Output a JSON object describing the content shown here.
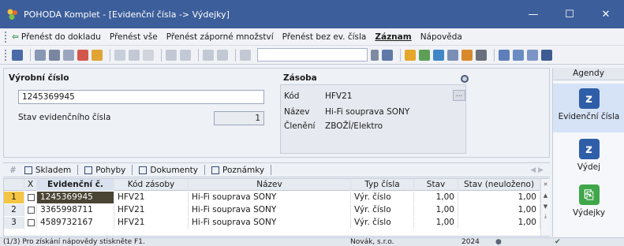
{
  "window": {
    "title": "POHODA Komplet - [Evidenční čísla -> Výdejky]",
    "minimize": "—",
    "maximize": "☐",
    "close": "✕"
  },
  "menu": {
    "items": [
      "Přenést do dokladu",
      "Přenést vše",
      "Přenést záporné množství",
      "Přenést bez ev. čísla",
      "Záznam",
      "Nápověda"
    ]
  },
  "form": {
    "vyrobni_cislo_label": "Výrobní číslo",
    "vyrobni_cislo_value": "1245369945",
    "stav_label": "Stav evidenčního čísla",
    "stav_value": "1",
    "zasoba_label": "Zásoba",
    "kod_label": "Kód",
    "kod_value": "HFV21",
    "nazev_label": "Název",
    "nazev_value": "Hi-Fi souprava SONY",
    "cleneni_label": "Členění",
    "cleneni_value": "ZBOŽÍ/Elektro",
    "dots": "..."
  },
  "agendy": {
    "header": "Agendy",
    "items": [
      {
        "label": "Evidenční čísla",
        "icon": "pohoda-z-icon"
      },
      {
        "label": "Výdej",
        "icon": "pohoda-z-icon"
      },
      {
        "label": "Výdejky",
        "icon": "document-green-icon"
      }
    ]
  },
  "tabs": {
    "hash": "#",
    "items": [
      "Skladem",
      "Pohyby",
      "Dokumenty",
      "Poznámky"
    ]
  },
  "grid": {
    "columns": [
      "X",
      "Evidenční č.",
      "Kód zásoby",
      "Název",
      "Typ čísla",
      "Stav",
      "Stav (neuloženo)"
    ],
    "rows": [
      {
        "n": "1",
        "ev": "1245369945",
        "kod": "HFV21",
        "nazev": "Hi-Fi souprava SONY",
        "typ": "Výr. číslo",
        "stav": "1,00",
        "neul": "1,00"
      },
      {
        "n": "2",
        "ev": "3365998711",
        "kod": "HFV21",
        "nazev": "Hi-Fi souprava SONY",
        "typ": "Výr. číslo",
        "stav": "1,00",
        "neul": "1,00"
      },
      {
        "n": "3",
        "ev": "4589732167",
        "kod": "HFV21",
        "nazev": "Hi-Fi souprava SONY",
        "typ": "Výr. číslo",
        "stav": "1,00",
        "neul": "1,00"
      }
    ]
  },
  "status": {
    "hint": "(1/3) Pro získání nápovědy stiskněte F1.",
    "company": "Novák, s.r.o.",
    "year": "2024"
  }
}
